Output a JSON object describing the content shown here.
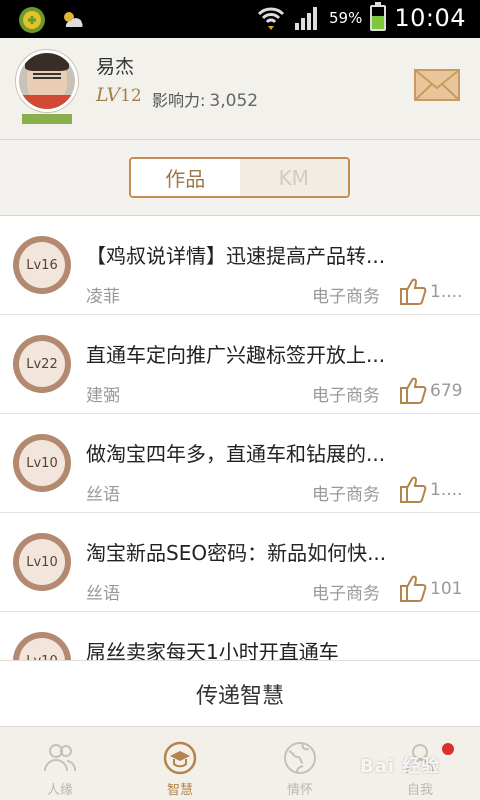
{
  "status_bar": {
    "battery_percent": "59%",
    "time": "10:04",
    "battery_level": 0.59,
    "icons": [
      "app-icon",
      "weather-icon",
      "wifi-icon",
      "signal-icon",
      "battery-icon"
    ]
  },
  "profile": {
    "name": "易杰",
    "level_prefix": "LV",
    "level": "12",
    "influence_label": "影响力:",
    "influence_value": "3,052"
  },
  "tabs": [
    {
      "label": "作品",
      "active": true
    },
    {
      "label": "KM",
      "active": false
    }
  ],
  "articles": [
    {
      "level": "Lv16",
      "title": "【鸡叔说详情】迅速提高产品转...",
      "author": "凌菲",
      "category": "电子商务",
      "likes": "1...."
    },
    {
      "level": "Lv22",
      "title": "直通车定向推广兴趣标签开放上...",
      "author": "建弻",
      "category": "电子商务",
      "likes": "679"
    },
    {
      "level": "Lv10",
      "title": "做淘宝四年多，直通车和钻展的...",
      "author": "丝语",
      "category": "电子商务",
      "likes": "1...."
    },
    {
      "level": "Lv10",
      "title": "淘宝新品SEO密码：新品如何快...",
      "author": "丝语",
      "category": "电子商务",
      "likes": "101"
    },
    {
      "level": "Lv10",
      "title": "屌丝卖家每天1小时开直通车",
      "author": "",
      "category": "",
      "likes": ""
    }
  ],
  "pass_button": {
    "label": "传递智慧"
  },
  "nav": [
    {
      "label": "人缘",
      "icon": "people-icon",
      "active": false
    },
    {
      "label": "智慧",
      "icon": "graduation-cap-icon",
      "active": true
    },
    {
      "label": "情怀",
      "icon": "globe-icon",
      "active": false
    },
    {
      "label": "自我",
      "icon": "user-icon",
      "active": false
    }
  ],
  "watermark": "Bai 经验",
  "colors": {
    "accent": "#b3844c",
    "tab_border": "#c58c54",
    "level_bar": "#89b04a",
    "notification_dot": "#d9302c"
  }
}
